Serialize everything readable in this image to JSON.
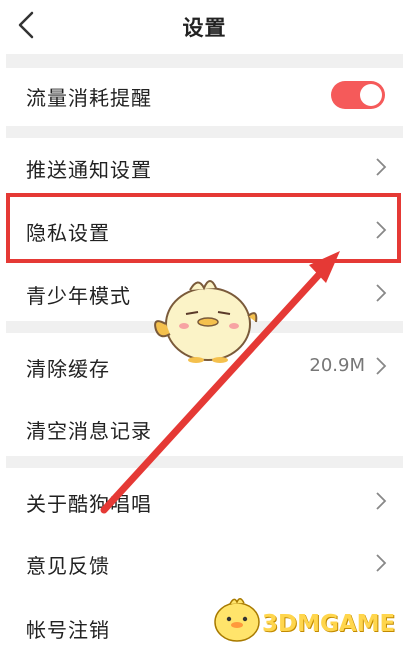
{
  "header": {
    "title": "设置",
    "back_icon": "back-chevron-icon"
  },
  "sections": {
    "traffic": {
      "label": "流量消耗提醒",
      "toggle_on": true,
      "toggle_color": "#f55a5a"
    },
    "push": {
      "label": "推送通知设置"
    },
    "privacy": {
      "label": "隐私设置",
      "highlighted": true,
      "highlight_color": "#e53935"
    },
    "youth": {
      "label": "青少年模式"
    },
    "cache": {
      "label": "清除缓存",
      "value": "20.9M"
    },
    "messages": {
      "label": "清空消息记录"
    },
    "about": {
      "label": "关于酷狗唱唱"
    },
    "feedback": {
      "label": "意见反馈"
    },
    "account": {
      "label": "帐号注销"
    }
  },
  "watermark": {
    "text": "3DMGAME"
  },
  "annotation": {
    "arrow_color": "#e53935"
  }
}
